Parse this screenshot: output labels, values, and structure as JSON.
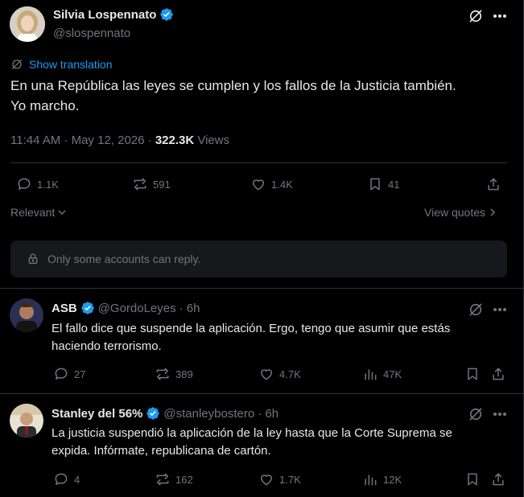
{
  "main_tweet": {
    "author_name": "Silvia Lospennato",
    "author_handle": "@slospennato",
    "show_translation": "Show translation",
    "text_line1": "En una República las leyes se cumplen y los fallos de la Justicia también.",
    "text_line2": "Yo marcho.",
    "time": "11:44 AM · May 12, 2026 · ",
    "views_count": "322.3K",
    "views_label": " Views",
    "replies": "1.1K",
    "reposts": "591",
    "likes": "1.4K",
    "bookmarks": "41",
    "sort_label": "Relevant",
    "view_quotes": "View quotes",
    "reply_restriction": "Only some accounts can reply."
  },
  "replies": [
    {
      "author_name": "ASB",
      "author_handle": "@GordoLeyes",
      "age": "· 6h",
      "text_line1": "El fallo dice que suspende la aplicación. Ergo, tengo que asumir que estás",
      "text_line2": "haciendo terrorismo.",
      "replies": "27",
      "reposts": "389",
      "likes": "4.7K",
      "views": "47K"
    },
    {
      "author_name": "Stanley del 56%",
      "author_handle": "@stanleybostero",
      "age": "· 6h",
      "text_line1": "La justicia suspendió la aplicación de la ley hasta que la Corte Suprema se",
      "text_line2": "expida. Infórmate, republicana de cartón.",
      "replies": "4",
      "reposts": "162",
      "likes": "1.7K",
      "views": "12K"
    }
  ],
  "colors": {
    "accent": "#1d9bf0",
    "muted": "#71767b",
    "border": "#2f3336",
    "text": "#e7e9ea"
  }
}
